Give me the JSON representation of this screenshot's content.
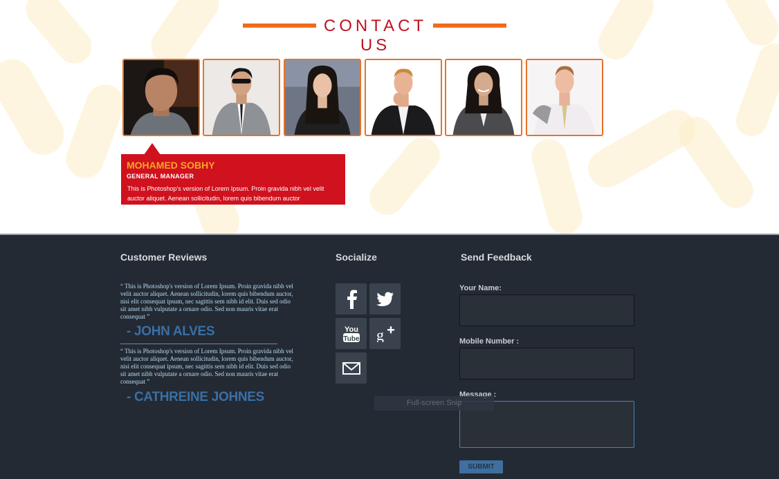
{
  "section_title": "CONTACT US",
  "team": [
    {
      "name": "member-1"
    },
    {
      "name": "member-2"
    },
    {
      "name": "member-3"
    },
    {
      "name": "member-4"
    },
    {
      "name": "member-5"
    },
    {
      "name": "member-6"
    }
  ],
  "selected_member": {
    "name": "MOHAMED SOBHY",
    "role": "GENERAL MANAGER",
    "bio": "This is Photoshop's version  of Lorem Ipsum. Proin gravida nibh vel velit auctor aliquet. Aenean sollicitudin, lorem quis bibendum auctor"
  },
  "footer": {
    "reviews_title": "Customer Reviews",
    "reviews": [
      {
        "text": "“ This is Photoshop's version of Lorem Ipsum. Proin gravida nibh vel velit auctor aliquet. Aenean sollicitudin, lorem quis bibendum auctor, nisi elit consequat ipsum, nec sagittis sem nibh id elit. Duis sed odio sit amet nibh vulputate a ornare odio. Sed non mauris vitae erat consequat ”",
        "author": "- JOHN ALVES"
      },
      {
        "text": "“ This is Photoshop's version of Lorem Ipsum. Proin gravida nibh vel velit auctor aliquet. Aenean sollicitudin, lorem quis bibendum auctor, nisi elit consequat ipsum, nec sagittis sem nibh id elit. Duis sed odio sit amet nibh vulputate a ornare odio. Sed non mauris vitae erat consequat ”",
        "author": "- CATHREINE JOHNES"
      }
    ],
    "social_title": "Socialize",
    "social_icons": [
      "facebook-icon",
      "twitter-icon",
      "youtube-icon",
      "google-plus-icon",
      "mail-icon"
    ],
    "feedback_title": "Send Feedback",
    "name_label": "Your Name:",
    "mobile_label": "Mobile Number :",
    "message_label": "Message :",
    "submit_label": "SUBMIT",
    "snip_overlay": "Full-screen Snip"
  },
  "colors": {
    "accent_orange": "#f26a1b",
    "accent_red": "#d0111e",
    "footer_bg": "#232a33",
    "review_author": "#3a6fa6"
  }
}
